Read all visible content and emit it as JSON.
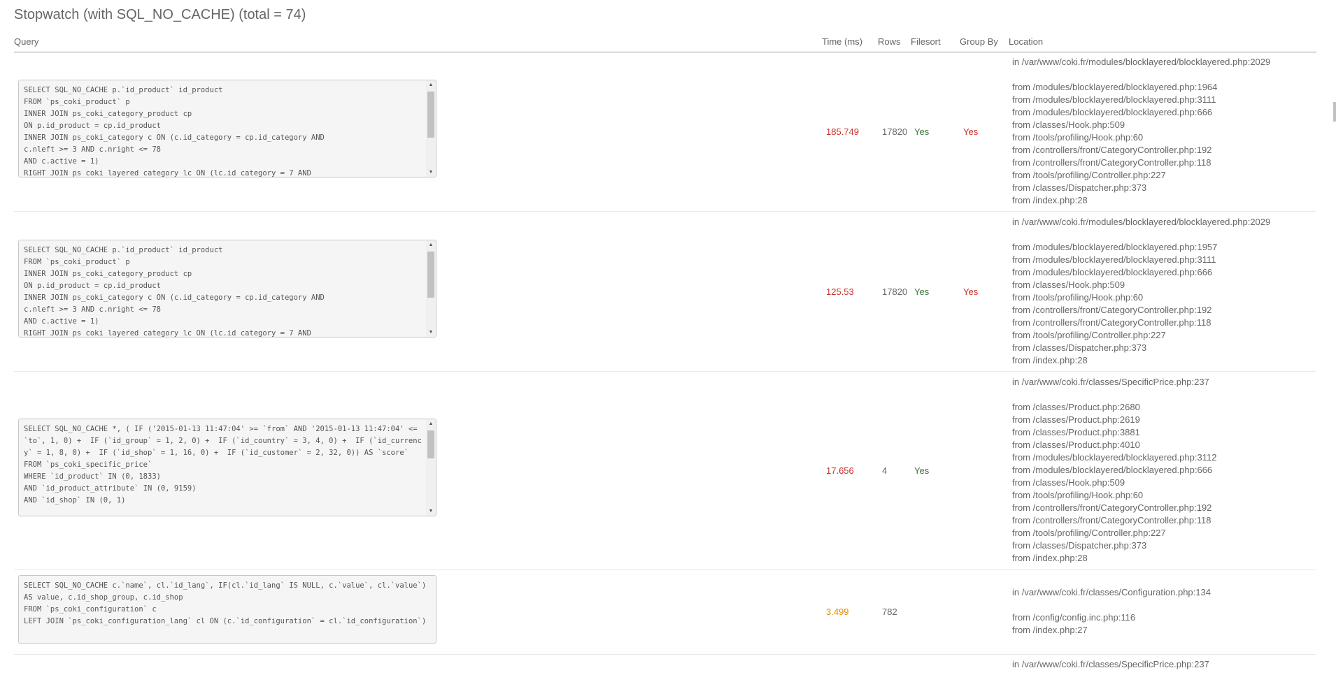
{
  "title": "Stopwatch (with SQL_NO_CACHE) (total = 74)",
  "columns": {
    "query": "Query",
    "time": "Time (ms)",
    "rows": "Rows",
    "filesort": "Filesort",
    "group_by": "Group By",
    "location": "Location"
  },
  "colors": {
    "time_high": "#c9302c",
    "time_low": "#e08e0b",
    "filesort_yes": "#3c763d",
    "group_by_yes": "#c9302c"
  },
  "entries": [
    {
      "query": "SELECT SQL_NO_CACHE p.`id_product` id_product\nFROM `ps_coki_product` p\nINNER JOIN ps_coki_category_product cp\nON p.id_product = cp.id_product\nINNER JOIN ps_coki_category c ON (c.id_category = cp.id_category AND\nc.nleft >= 3 AND c.nright <= 78\nAND c.active = 1)\nRIGHT JOIN ps_coki_layered_category lc ON (lc.id_category = 7 AND",
      "time": "185.749",
      "rows": "17820",
      "filesort": "Yes",
      "group_by": "Yes",
      "location_in": "in /var/www/coki.fr/modules/blocklayered/blocklayered.php:2029",
      "trace": [
        "from /modules/blocklayered/blocklayered.php:1964",
        "from /modules/blocklayered/blocklayered.php:3111",
        "from /modules/blocklayered/blocklayered.php:666",
        "from /classes/Hook.php:509",
        "from /tools/profiling/Hook.php:60",
        "from /controllers/front/CategoryController.php:192",
        "from /controllers/front/CategoryController.php:118",
        "from /tools/profiling/Controller.php:227",
        "from /classes/Dispatcher.php:373",
        "from /index.php:28"
      ]
    },
    {
      "query": "SELECT SQL_NO_CACHE p.`id_product` id_product\nFROM `ps_coki_product` p\nINNER JOIN ps_coki_category_product cp\nON p.id_product = cp.id_product\nINNER JOIN ps_coki_category c ON (c.id_category = cp.id_category AND\nc.nleft >= 3 AND c.nright <= 78\nAND c.active = 1)\nRIGHT JOIN ps_coki_layered_category lc ON (lc.id_category = 7 AND",
      "time": "125.53",
      "rows": "17820",
      "filesort": "Yes",
      "group_by": "Yes",
      "location_in": "in /var/www/coki.fr/modules/blocklayered/blocklayered.php:2029",
      "trace": [
        "from /modules/blocklayered/blocklayered.php:1957",
        "from /modules/blocklayered/blocklayered.php:3111",
        "from /modules/blocklayered/blocklayered.php:666",
        "from /classes/Hook.php:509",
        "from /tools/profiling/Hook.php:60",
        "from /controllers/front/CategoryController.php:192",
        "from /controllers/front/CategoryController.php:118",
        "from /tools/profiling/Controller.php:227",
        "from /classes/Dispatcher.php:373",
        "from /index.php:28"
      ]
    },
    {
      "query": "SELECT SQL_NO_CACHE *, ( IF ('2015-01-13 11:47:04' >= `from` AND '2015-01-13 11:47:04' <= `to`, 1, 0) +  IF (`id_group` = 1, 2, 0) +  IF (`id_country` = 3, 4, 0) +  IF (`id_currency` = 1, 8, 0) +  IF (`id_shop` = 1, 16, 0) +  IF (`id_customer` = 2, 32, 0)) AS `score`\nFROM `ps_coki_specific_price`\nWHERE `id_product` IN (0, 1833)\nAND `id_product_attribute` IN (0, 9159)\nAND `id_shop` IN (0, 1)",
      "time": "17.656",
      "rows": "4",
      "filesort": "Yes",
      "group_by": "",
      "location_in": "in /var/www/coki.fr/classes/SpecificPrice.php:237",
      "trace": [
        "from /classes/Product.php:2680",
        "from /classes/Product.php:2619",
        "from /classes/Product.php:3881",
        "from /classes/Product.php:4010",
        "from /modules/blocklayered/blocklayered.php:3112",
        "from /modules/blocklayered/blocklayered.php:666",
        "from /classes/Hook.php:509",
        "from /tools/profiling/Hook.php:60",
        "from /controllers/front/CategoryController.php:192",
        "from /controllers/front/CategoryController.php:118",
        "from /tools/profiling/Controller.php:227",
        "from /classes/Dispatcher.php:373",
        "from /index.php:28"
      ]
    },
    {
      "query": "SELECT SQL_NO_CACHE c.`name`, cl.`id_lang`, IF(cl.`id_lang` IS NULL, c.`value`, cl.`value`) AS value, c.id_shop_group, c.id_shop\nFROM `ps_coki_configuration` c\nLEFT JOIN `ps_coki_configuration_lang` cl ON (c.`id_configuration` = cl.`id_configuration`)",
      "time": "3.499",
      "rows": "782",
      "filesort": "",
      "group_by": "",
      "location_in": "in /var/www/coki.fr/classes/Configuration.php:134",
      "trace": [
        "from /config/config.inc.php:116",
        "from /index.php:27"
      ]
    },
    {
      "location_in": "in /var/www/coki.fr/classes/SpecificPrice.php:237"
    }
  ]
}
